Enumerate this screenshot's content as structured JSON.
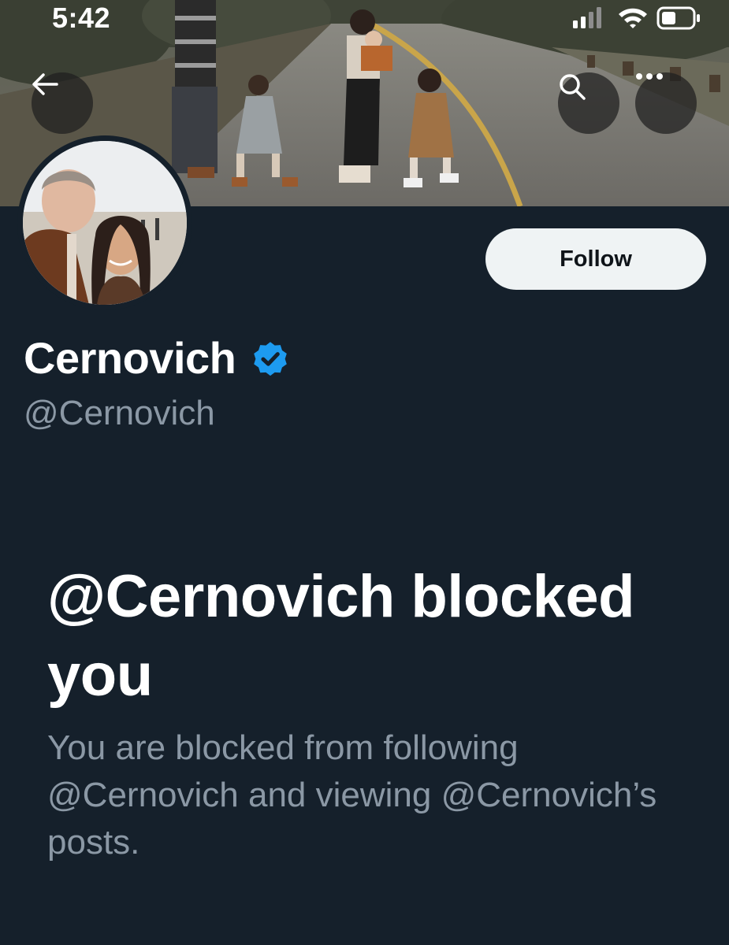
{
  "status_bar": {
    "time": "5:42"
  },
  "profile": {
    "display_name": "Cernovich",
    "handle": "@Cernovich",
    "verified": true,
    "follow_label": "Follow"
  },
  "blocked_notice": {
    "title": "@Cernovich blocked you",
    "description": "You are blocked from following @Cernovich and viewing @Cernovich’s posts."
  },
  "colors": {
    "background": "#15202b",
    "verified_blue": "#1d9bf0",
    "muted_text": "#8b98a5",
    "follow_button_bg": "#eff3f4"
  },
  "icons": {
    "back": "arrow-left-icon",
    "search": "search-icon",
    "more": "more-horizontal-icon",
    "verified": "verified-badge-icon",
    "signal": "signal-icon",
    "wifi": "wifi-icon",
    "battery": "battery-icon"
  }
}
